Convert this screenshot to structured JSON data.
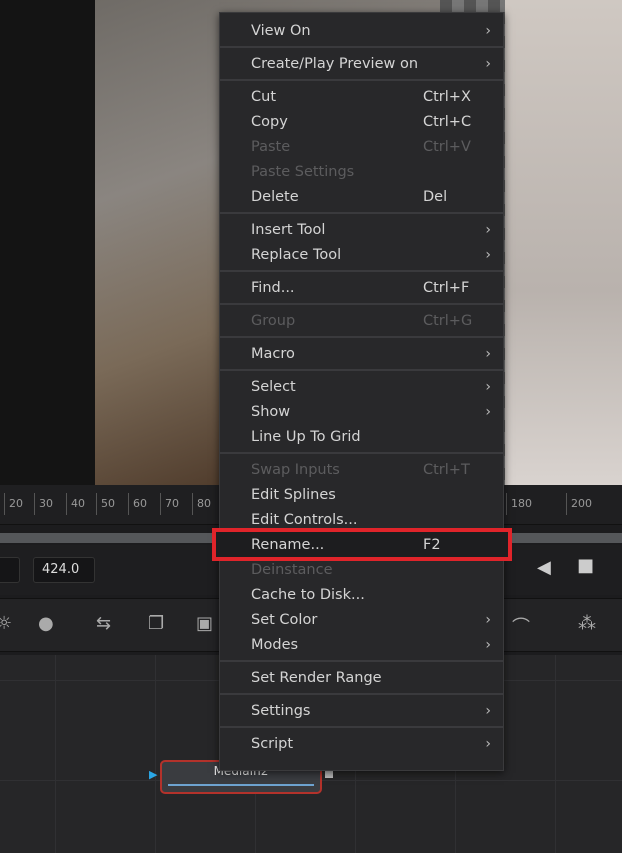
{
  "ruler": {
    "ticks": [
      "20",
      "30",
      "40",
      "50",
      "60",
      "70",
      "80",
      "180",
      "200"
    ]
  },
  "controls": {
    "frame_value": "424.0"
  },
  "node": {
    "label": "MediaIn2"
  },
  "menu": {
    "highlight_color": "#e0242a",
    "groups": [
      [
        {
          "label": "View On",
          "submenu": true
        }
      ],
      [
        {
          "label": "Create/Play Preview on",
          "submenu": true
        }
      ],
      [
        {
          "label": "Cut",
          "shortcut": "Ctrl+X"
        },
        {
          "label": "Copy",
          "shortcut": "Ctrl+C"
        },
        {
          "label": "Paste",
          "shortcut": "Ctrl+V",
          "disabled": true
        },
        {
          "label": "Paste Settings",
          "disabled": true
        },
        {
          "label": "Delete",
          "shortcut": "Del"
        }
      ],
      [
        {
          "label": "Insert Tool",
          "submenu": true
        },
        {
          "label": "Replace Tool",
          "submenu": true
        }
      ],
      [
        {
          "label": "Find...",
          "shortcut": "Ctrl+F"
        }
      ],
      [
        {
          "label": "Group",
          "shortcut": "Ctrl+G",
          "disabled": true
        }
      ],
      [
        {
          "label": "Macro",
          "submenu": true
        }
      ],
      [
        {
          "label": "Select",
          "submenu": true
        },
        {
          "label": "Show",
          "submenu": true
        },
        {
          "label": "Line Up To Grid"
        }
      ],
      [
        {
          "label": "Swap Inputs",
          "shortcut": "Ctrl+T",
          "disabled": true
        },
        {
          "label": "Edit Splines"
        },
        {
          "label": "Edit Controls..."
        },
        {
          "label": "Rename...",
          "shortcut": "F2",
          "highlighted": true
        },
        {
          "label": "Deinstance",
          "disabled": true
        },
        {
          "label": "Cache to Disk..."
        },
        {
          "label": "Set Color",
          "submenu": true
        },
        {
          "label": "Modes",
          "submenu": true
        }
      ],
      [
        {
          "label": "Set Render Range"
        }
      ],
      [
        {
          "label": "Settings",
          "submenu": true
        }
      ],
      [
        {
          "label": "Script",
          "submenu": true
        }
      ]
    ]
  }
}
